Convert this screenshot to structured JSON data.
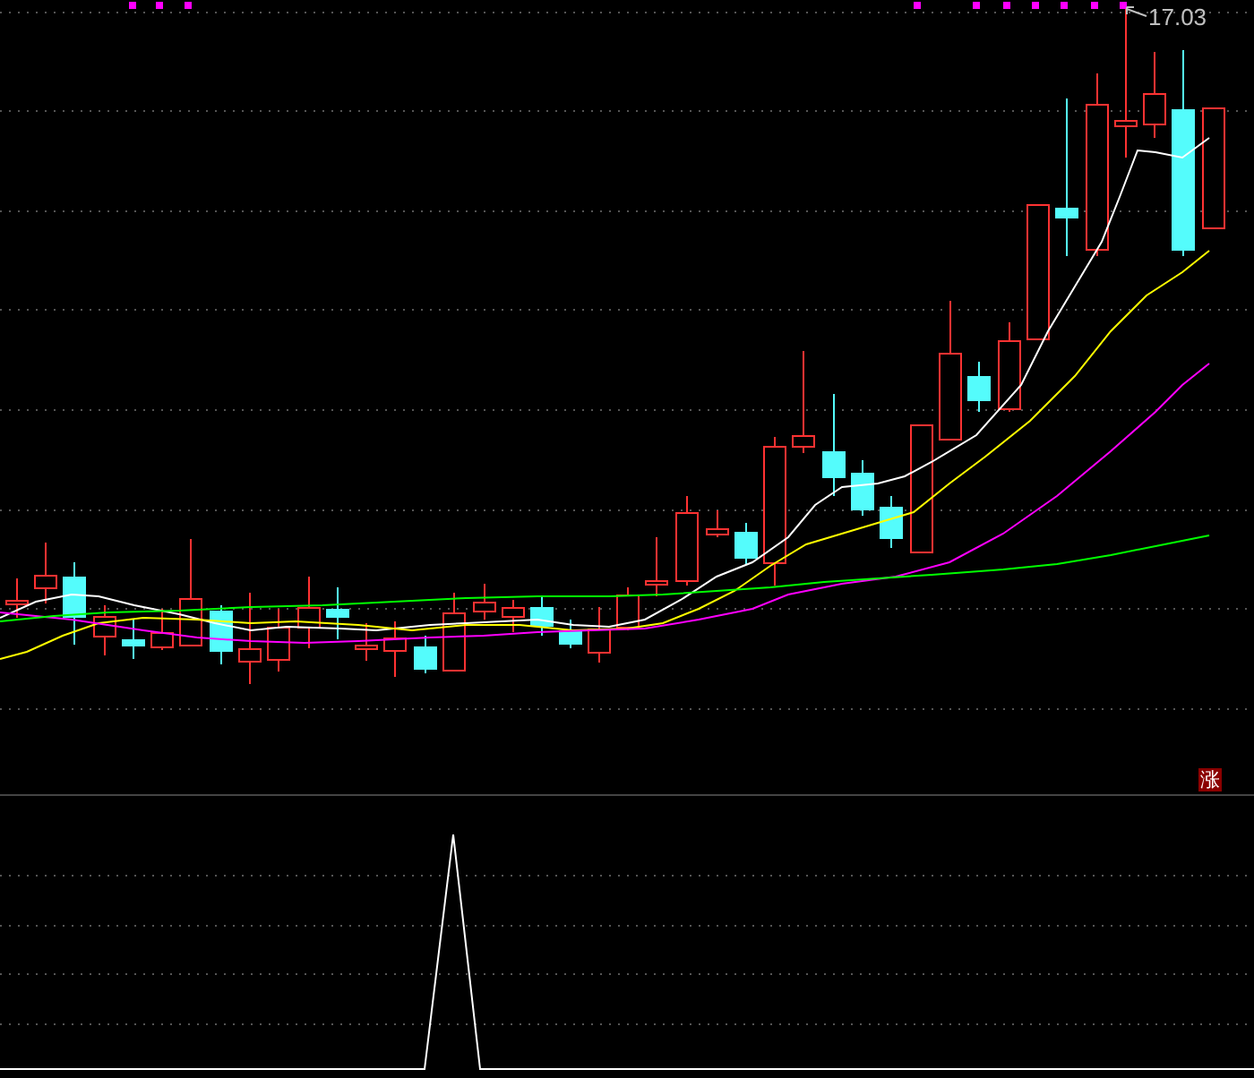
{
  "price_chart": {
    "high_label": "17.03"
  },
  "signal_badge": {
    "label": "涨"
  }
}
